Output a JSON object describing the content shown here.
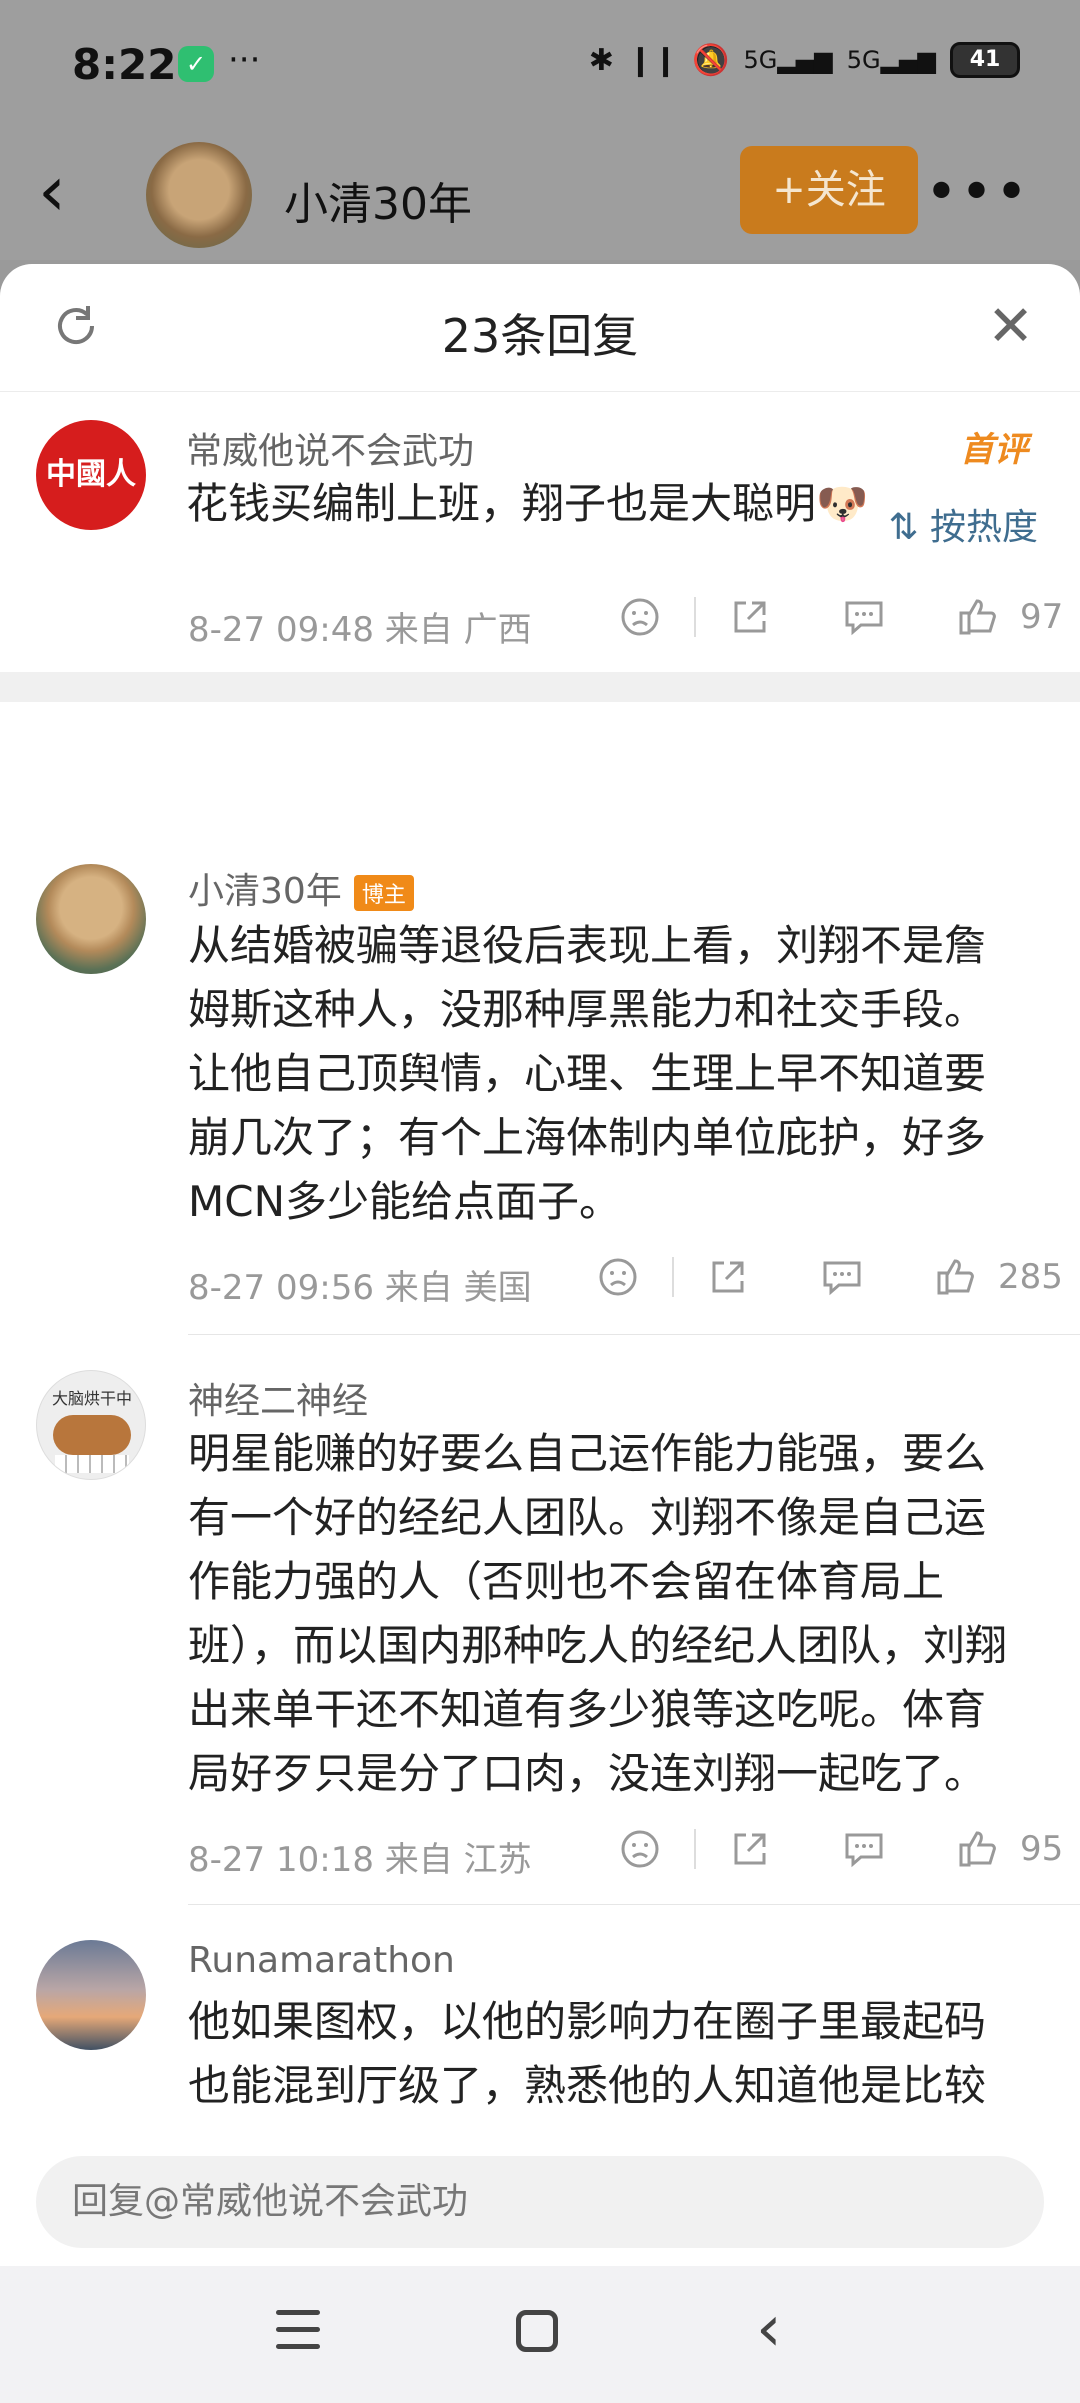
{
  "status": {
    "time": "8:22",
    "battery": "41",
    "more": "···"
  },
  "topnav": {
    "name": "小清30年",
    "follow": "+关注",
    "more": "•••"
  },
  "sheet": {
    "title": "23条回复"
  },
  "root": {
    "user": "常威他说不会武功",
    "avatar_text": "中國人",
    "badge": "首评",
    "text": "花钱买编制上班，翔子也是大聪明🐶",
    "meta": "8-27 09:48  来自 广西",
    "likes": "97"
  },
  "sort": {
    "label": "按热度"
  },
  "replies": [
    {
      "user": "小清30年",
      "badge": "博主",
      "lines": [
        "从结婚被骗等退役后表现上看，刘翔不是詹",
        "姆斯这种人，没那种厚黑能力和社交手段。",
        "让他自己顶舆情，心理、生理上早不知道要",
        "崩几次了；有个上海体制内单位庇护，好多",
        "MCN多少能给点面子。"
      ],
      "meta": "8-27 09:56  来自 美国",
      "likes": "285"
    },
    {
      "user": "神经二神经",
      "avatar_text": "大脑烘干中",
      "lines": [
        "明星能赚的好要么自己运作能力能强，要么",
        "有一个好的经纪人团队。刘翔不像是自己运",
        "作能力强的人（否则也不会留在体育局上",
        "班），而以国内那种吃人的经纪人团队，刘翔",
        "出来单干还不知道有多少狼等这吃呢。体育",
        "局好歹只是分了口肉，没连刘翔一起吃了。"
      ],
      "meta": "8-27 10:18  来自 江苏",
      "likes": "95"
    },
    {
      "user": "Runamarathon",
      "lines": [
        "他如果图权，以他的影响力在圈子里最起码",
        "也能混到厅级了，熟悉他的人知道他是比较"
      ]
    }
  ],
  "input": {
    "placeholder": "回复@常威他说不会武功"
  }
}
